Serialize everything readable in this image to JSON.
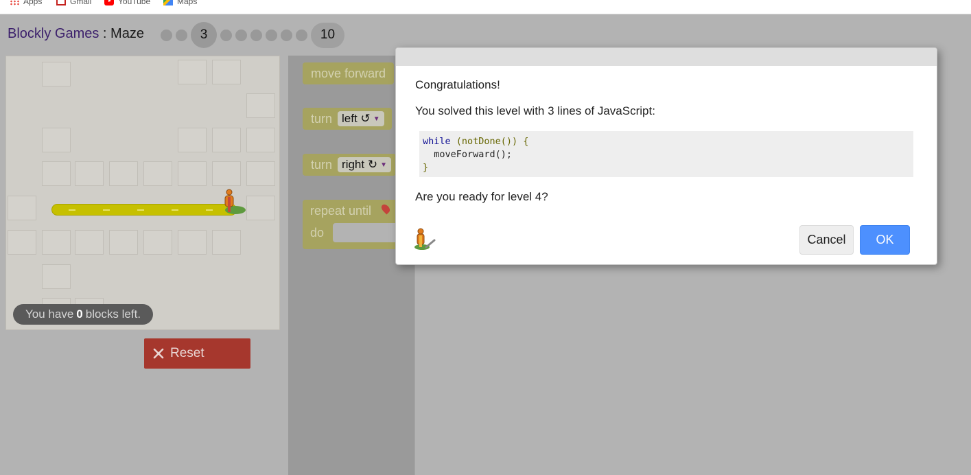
{
  "bookmarks": [
    {
      "label": "Apps",
      "icon": "apps-grid-icon"
    },
    {
      "label": "Gmail",
      "icon": "gmail-icon"
    },
    {
      "label": "YouTube",
      "icon": "youtube-icon"
    },
    {
      "label": "Maps",
      "icon": "maps-icon"
    }
  ],
  "header": {
    "brand": "Blockly Games",
    "separator": " : ",
    "game": "Maze",
    "current_level": "3",
    "last_level": "10"
  },
  "maze": {
    "blocks_left_prefix": "You have",
    "blocks_left_count": "0",
    "blocks_left_suffix": "blocks left.",
    "reset_label": "Reset"
  },
  "toolbox": {
    "move_forward": "move forward",
    "turn": "turn",
    "left_option": "left ↺",
    "right_option": "right ↻",
    "repeat_until": "repeat until",
    "do": "do"
  },
  "dialog": {
    "congrats": "Congratulations!",
    "solved": "You solved this level with 3 lines of JavaScript:",
    "code_line1_kw": "while",
    "code_line1_rest": " (notDone()) {",
    "code_line2": "  moveForward();",
    "code_line3": "}",
    "ready": "Are you ready for level 4?",
    "cancel_label": "Cancel",
    "ok_label": "OK"
  },
  "colors": {
    "ok_button": "#4d90fe",
    "reset_button": "#a6372d",
    "path": "#c6c000",
    "block": "#a6a35f"
  }
}
